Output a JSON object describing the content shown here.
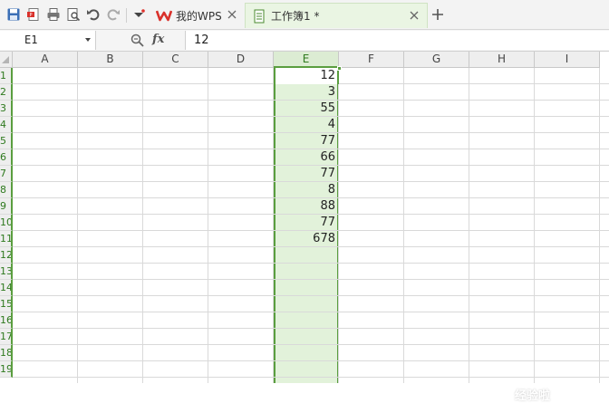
{
  "toolbar": {
    "icons": [
      "save-icon",
      "export-pdf-icon",
      "print-icon",
      "print-preview-icon",
      "undo-icon",
      "redo-icon",
      "customize-dropdown-icon"
    ]
  },
  "tabs": [
    {
      "label": "我的WPS",
      "icon": "wps-logo-icon",
      "active": false
    },
    {
      "label": "工作簿1 *",
      "icon": "spreadsheet-doc-icon",
      "active": true
    }
  ],
  "formula_bar": {
    "cell_ref": "E1",
    "fx_label": "fx",
    "value": "12"
  },
  "columns": [
    "A",
    "B",
    "C",
    "D",
    "E",
    "F",
    "G",
    "H",
    "I"
  ],
  "active_column": "E",
  "rows": [
    "1",
    "2",
    "3",
    "4",
    "5",
    "6",
    "7",
    "8",
    "9",
    "10",
    "11",
    "12",
    "13",
    "14",
    "15",
    "16",
    "17",
    "18",
    "19"
  ],
  "column_e_values": [
    "12",
    "3",
    "55",
    "4",
    "77",
    "66",
    "77",
    "8",
    "88",
    "77",
    "678"
  ],
  "watermark": "经验啦",
  "colors": {
    "accent": "#5a9e3f",
    "selection": "#e2f2da",
    "tab_active": "#eaf5e3"
  }
}
